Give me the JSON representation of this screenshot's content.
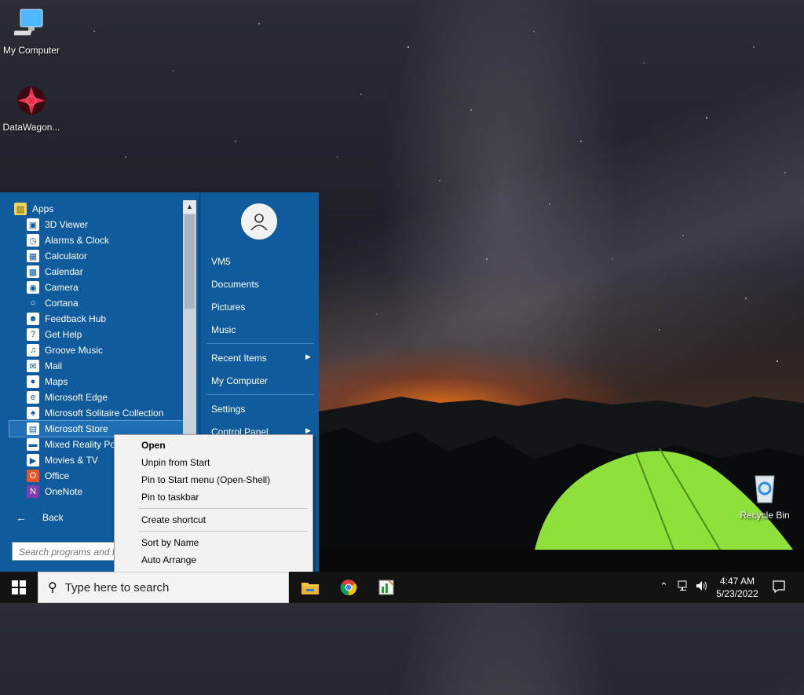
{
  "desktop": {
    "icons": [
      {
        "label": "My Computer"
      },
      {
        "label": "DataWagon..."
      },
      {
        "label": "Recycle Bin"
      }
    ]
  },
  "start_menu": {
    "apps_header": "Apps",
    "apps": [
      {
        "label": "3D Viewer",
        "icon": "cube-icon"
      },
      {
        "label": "Alarms & Clock",
        "icon": "clock-icon"
      },
      {
        "label": "Calculator",
        "icon": "calculator-icon"
      },
      {
        "label": "Calendar",
        "icon": "calendar-icon"
      },
      {
        "label": "Camera",
        "icon": "camera-icon"
      },
      {
        "label": "Cortana",
        "icon": "circle-icon"
      },
      {
        "label": "Feedback Hub",
        "icon": "person-icon"
      },
      {
        "label": "Get Help",
        "icon": "help-icon"
      },
      {
        "label": "Groove Music",
        "icon": "music-icon"
      },
      {
        "label": "Mail",
        "icon": "mail-icon"
      },
      {
        "label": "Maps",
        "icon": "map-pin-icon"
      },
      {
        "label": "Microsoft Edge",
        "icon": "edge-icon"
      },
      {
        "label": "Microsoft Solitaire Collection",
        "icon": "cards-icon"
      },
      {
        "label": "Microsoft Store",
        "icon": "store-icon"
      },
      {
        "label": "Mixed Reality Po",
        "icon": "headset-icon"
      },
      {
        "label": "Movies & TV",
        "icon": "film-icon"
      },
      {
        "label": "Office",
        "icon": "office-icon"
      },
      {
        "label": "OneNote",
        "icon": "onenote-icon"
      }
    ],
    "right": {
      "user": "VM5",
      "documents": "Documents",
      "pictures": "Pictures",
      "music": "Music",
      "recent_items": "Recent Items",
      "my_computer": "My Computer",
      "settings": "Settings",
      "control_panel": "Control Panel"
    },
    "back_label": "Back",
    "search_placeholder": "Search programs and fi"
  },
  "context_menu": {
    "items": [
      "Open",
      "Unpin from Start",
      "Pin to Start menu (Open-Shell)",
      "Pin to taskbar",
      "Create shortcut",
      "Sort by Name",
      "Auto Arrange"
    ]
  },
  "taskbar": {
    "search_text": "Type here to search",
    "time": "4:47 AM",
    "date": "5/23/2022"
  },
  "colors": {
    "start_bg": "#0f5b9e",
    "taskbar_bg": "#131313",
    "tent": "#8ee03a"
  }
}
